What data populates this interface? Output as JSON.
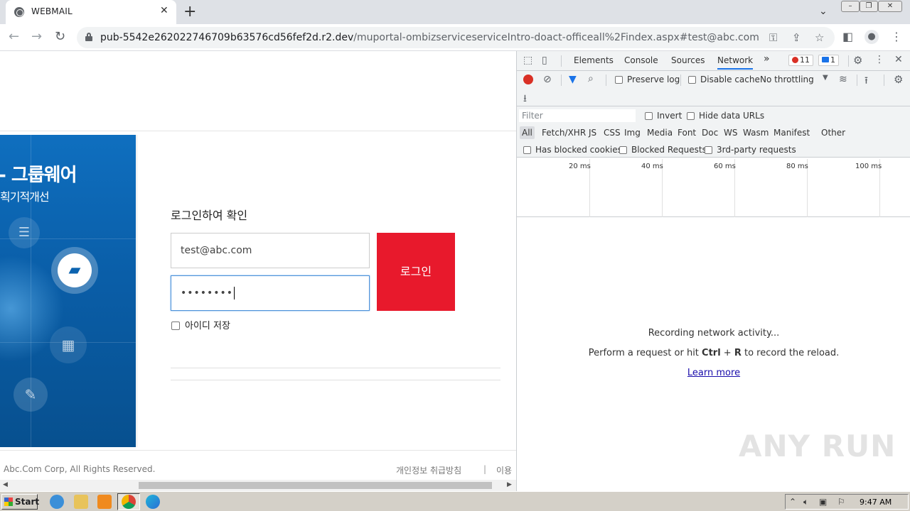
{
  "browser": {
    "tab_title": "WEBMAIL",
    "url_domain": "pub-5542e262022746709b63576cd56fef2d.r2.dev",
    "url_path": "/muportal-ombizserviceserviceIntro-doact-officeall%2Findex.aspx#test@abc.com"
  },
  "page": {
    "banner_title": "- 그룹웨어",
    "banner_subtitle": "획기적개선",
    "login_title": "로그인하여 확인",
    "email_value": "test@abc.com",
    "password_value": "••••••••",
    "login_button": "로그인",
    "remember_label": "아이디 저장",
    "copyright": "Abc.Com Corp, All Rights Reserved.",
    "privacy_link": "개인정보 취급방침",
    "footer_separator": "|",
    "terms_link": "이용"
  },
  "devtools": {
    "tabs": [
      "Elements",
      "Console",
      "Sources",
      "Network"
    ],
    "more_tabs": "»",
    "error_count": "11",
    "message_count": "1",
    "preserve_log": "Preserve log",
    "disable_cache": "Disable cache",
    "throttling": "No throttling",
    "filter_placeholder": "Filter",
    "invert": "Invert",
    "hide_data_urls": "Hide data URLs",
    "type_filters": [
      "All",
      "Fetch/XHR",
      "JS",
      "CSS",
      "Img",
      "Media",
      "Font",
      "Doc",
      "WS",
      "Wasm",
      "Manifest",
      "Other"
    ],
    "has_blocked_cookies": "Has blocked cookies",
    "blocked_requests": "Blocked Requests",
    "third_party": "3rd-party requests",
    "timeline_ticks": [
      "20 ms",
      "40 ms",
      "60 ms",
      "80 ms",
      "100 ms"
    ],
    "empty_line1": "Recording network activity...",
    "empty_line2_pre": "Perform a request or hit ",
    "empty_line2_key1": "Ctrl",
    "empty_line2_plus": " + ",
    "empty_line2_key2": "R",
    "empty_line2_post": " to record the reload.",
    "learn_more": "Learn more"
  },
  "watermark": "ANY RUN",
  "taskbar": {
    "start": "Start",
    "clock": "9:47 AM"
  },
  "colors": {
    "login_button": "#e8192c",
    "banner_blue": "#0a5ea8",
    "devtools_accent": "#1a73e8"
  }
}
